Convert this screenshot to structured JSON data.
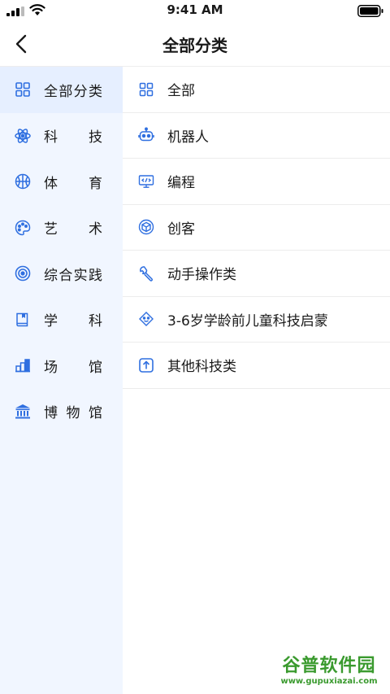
{
  "status_bar": {
    "time": "9:41 AM"
  },
  "nav": {
    "title": "全部分类"
  },
  "sidebar": {
    "items": [
      {
        "label": "全部分类",
        "icon": "grid-icon",
        "active": true
      },
      {
        "label": "科技",
        "icon": "atom-icon",
        "active": false
      },
      {
        "label": "体育",
        "icon": "basketball-icon",
        "active": false
      },
      {
        "label": "艺术",
        "icon": "palette-icon",
        "active": false
      },
      {
        "label": "综合实践",
        "icon": "target-icon",
        "active": false
      },
      {
        "label": "学科",
        "icon": "book-icon",
        "active": false
      },
      {
        "label": "场馆",
        "icon": "building-icon",
        "active": false
      },
      {
        "label": "博物馆",
        "icon": "museum-icon",
        "active": false
      }
    ]
  },
  "categories": {
    "items": [
      {
        "label": "全部",
        "icon": "grid-icon"
      },
      {
        "label": "机器人",
        "icon": "robot-icon"
      },
      {
        "label": "编程",
        "icon": "code-monitor-icon"
      },
      {
        "label": "创客",
        "icon": "cube-icon"
      },
      {
        "label": "动手操作类",
        "icon": "wrench-icon"
      },
      {
        "label": "3-6岁学龄前儿童科技启蒙",
        "icon": "child-face-icon"
      },
      {
        "label": "其他科技类",
        "icon": "upload-box-icon"
      }
    ]
  },
  "watermark": {
    "brand": "谷普软件园",
    "url": "www.gupuxiazai.com"
  },
  "colors": {
    "accent": "#2f6fe0",
    "sidebar_bg": "#f1f6ff",
    "sidebar_active_bg": "#e6efff",
    "watermark": "#3a9a2e"
  }
}
